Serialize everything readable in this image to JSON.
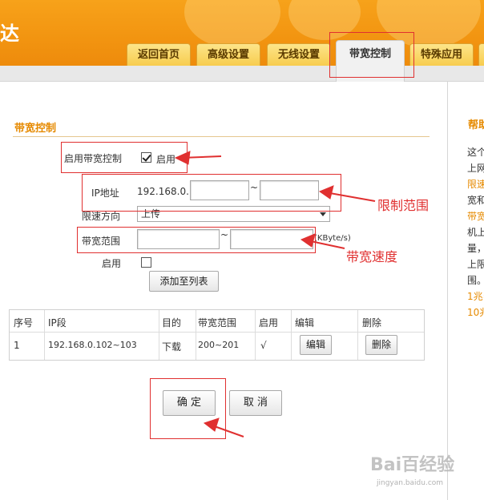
{
  "header": {
    "logo_text": "达",
    "colors": {
      "brand": "#f29410",
      "tab": "#f7cc4e",
      "accent": "#e68a00",
      "annotation": "#e03030"
    }
  },
  "tabs": [
    {
      "label": "返回首页",
      "active": false
    },
    {
      "label": "高级设置",
      "active": false
    },
    {
      "label": "无线设置",
      "active": false
    },
    {
      "label": "带宽控制",
      "active": true
    },
    {
      "label": "特殊应用",
      "active": false
    }
  ],
  "section": {
    "title": "带宽控制"
  },
  "form": {
    "enable_label": "启用带宽控制",
    "enable_checkbox_label": "启用",
    "enable_checked": true,
    "ip_label": "IP地址",
    "ip_prefix": "192.168.0.",
    "ip_start": "",
    "ip_end": "",
    "tilde": "~",
    "direction_label": "限速方向",
    "direction_value": "上传",
    "range_label": "带宽范围",
    "range_min": "",
    "range_max": "",
    "unit": "(KByte/s)",
    "rule_enable_label": "启用",
    "rule_enable_checked": false,
    "add_button": "添加至列表"
  },
  "table": {
    "headers": [
      "序号",
      "IP段",
      "目的",
      "带宽范围",
      "启用",
      "编辑",
      "删除"
    ],
    "rows": [
      {
        "index": "1",
        "ip_range": "192.168.0.102~103",
        "direction": "下载",
        "bandwidth": "200~201",
        "enabled": "√",
        "edit": "编辑",
        "delete": "删除"
      }
    ]
  },
  "actions": {
    "confirm": "确 定",
    "cancel": "取 消"
  },
  "annotations": {
    "limit_range": "限制范围",
    "bandwidth_speed": "带宽速度"
  },
  "help": {
    "title": "帮助",
    "lines": [
      {
        "text": "这个",
        "orange": false
      },
      {
        "text": "上网",
        "orange": false
      },
      {
        "text": "限速",
        "orange": true
      },
      {
        "text": "宽和",
        "orange": false
      },
      {
        "text": "带宽",
        "orange": true
      },
      {
        "text": "机上",
        "orange": false
      },
      {
        "text": "量，",
        "orange": false
      },
      {
        "text": "上限",
        "orange": false
      },
      {
        "text": "围。",
        "orange": false
      },
      {
        "text": "1兆=",
        "orange": true
      },
      {
        "text": "10兆",
        "orange": true
      }
    ]
  },
  "watermark": {
    "text": "Bai百经验",
    "sub": "jingyan.baidu.com"
  }
}
